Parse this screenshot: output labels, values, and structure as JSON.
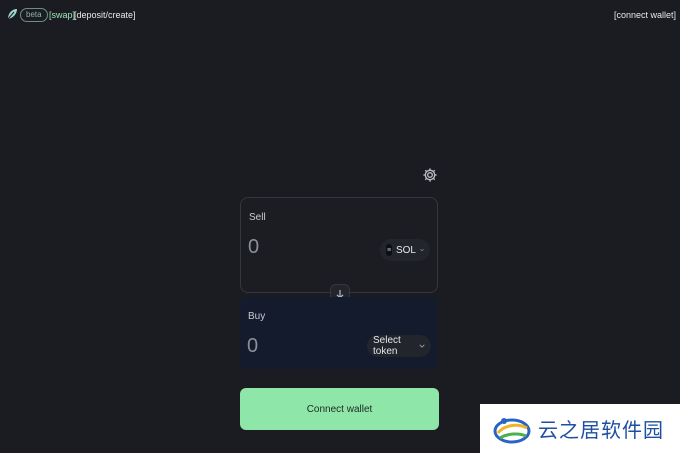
{
  "nav": {
    "badge": "beta",
    "links": {
      "swap": "[swap]",
      "deposit": "[deposit/create]"
    },
    "connect": "[connect wallet]"
  },
  "settings": {
    "icon": "gear-icon"
  },
  "sell": {
    "label": "Sell",
    "amount": "0",
    "token": {
      "symbol": "SOL",
      "icon_glyph": "≡"
    }
  },
  "swap": {
    "icon": "arrow-down-icon"
  },
  "buy": {
    "label": "Buy",
    "amount": "0",
    "token_button": "Select token"
  },
  "cta": {
    "label": "Connect wallet"
  },
  "watermark": {
    "text": "云之居软件园"
  },
  "colors": {
    "background": "#1a1c21",
    "accent": "#8ee6a8",
    "buy_panel": "#141b2d"
  }
}
